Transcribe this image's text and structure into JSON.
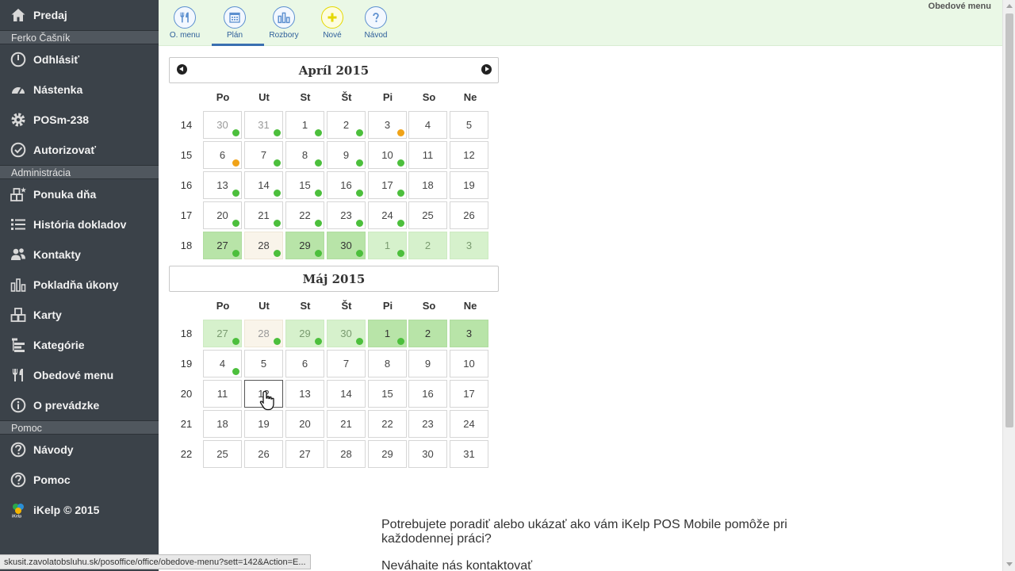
{
  "sidebar": {
    "top": {
      "label": "Predaj",
      "icon": "home-icon"
    },
    "section_user": "Ferko Čašník",
    "group1": [
      {
        "label": "Odhlásiť",
        "icon": "power-icon"
      },
      {
        "label": "Nástenka",
        "icon": "dashboard-icon"
      },
      {
        "label": "POSm-238",
        "icon": "gear-icon"
      },
      {
        "label": "Autorizovať",
        "icon": "check-circle-icon"
      }
    ],
    "section_admin": "Administrácia",
    "group2": [
      {
        "label": "Ponuka dňa",
        "icon": "boxes-star-icon"
      },
      {
        "label": "História dokladov",
        "icon": "list-icon"
      },
      {
        "label": "Kontakty",
        "icon": "users-icon"
      },
      {
        "label": "Pokladňa úkony",
        "icon": "bar-chart-icon"
      },
      {
        "label": "Karty",
        "icon": "cards-icon"
      },
      {
        "label": "Kategórie",
        "icon": "tree-icon"
      },
      {
        "label": "Obedové menu",
        "icon": "fork-knife-icon"
      },
      {
        "label": "O prevádzke",
        "icon": "info-icon"
      }
    ],
    "section_help": "Pomoc",
    "group3": [
      {
        "label": "Návody",
        "icon": "question-icon"
      },
      {
        "label": "Pomoc",
        "icon": "question-icon"
      },
      {
        "label": "iKelp © 2015",
        "icon": "ikelp-logo-icon"
      }
    ]
  },
  "toolbar": {
    "buttons": [
      {
        "label": "O. menu",
        "icon": "fork-knife-icon"
      },
      {
        "label": "Plán",
        "icon": "calendar-icon",
        "active": true
      },
      {
        "label": "Rozbory",
        "icon": "bar-chart-icon"
      },
      {
        "label": "Nové",
        "icon": "plus-icon"
      },
      {
        "label": "Návod",
        "icon": "question-icon"
      }
    ],
    "page_title": "Obedové menu"
  },
  "weekdays": [
    "Po",
    "Ut",
    "St",
    "Št",
    "Pi",
    "So",
    "Ne"
  ],
  "calendars": [
    {
      "title": "Apríl 2015",
      "weeks": [
        {
          "num": "14",
          "days": [
            {
              "d": "30",
              "other": true,
              "dot": "green"
            },
            {
              "d": "31",
              "other": true,
              "dot": "green"
            },
            {
              "d": "1",
              "dot": "green"
            },
            {
              "d": "2",
              "dot": "green"
            },
            {
              "d": "3",
              "dot": "orange"
            },
            {
              "d": "4"
            },
            {
              "d": "5"
            }
          ]
        },
        {
          "num": "15",
          "days": [
            {
              "d": "6",
              "dot": "orange"
            },
            {
              "d": "7",
              "dot": "green"
            },
            {
              "d": "8",
              "dot": "green"
            },
            {
              "d": "9",
              "dot": "green"
            },
            {
              "d": "10",
              "dot": "green"
            },
            {
              "d": "11"
            },
            {
              "d": "12"
            }
          ]
        },
        {
          "num": "16",
          "days": [
            {
              "d": "13",
              "dot": "green"
            },
            {
              "d": "14",
              "dot": "green"
            },
            {
              "d": "15",
              "dot": "green"
            },
            {
              "d": "16",
              "dot": "green"
            },
            {
              "d": "17",
              "dot": "green"
            },
            {
              "d": "18"
            },
            {
              "d": "19"
            }
          ]
        },
        {
          "num": "17",
          "days": [
            {
              "d": "20",
              "dot": "green"
            },
            {
              "d": "21",
              "dot": "green"
            },
            {
              "d": "22",
              "dot": "green"
            },
            {
              "d": "23",
              "dot": "green"
            },
            {
              "d": "24",
              "dot": "green"
            },
            {
              "d": "25"
            },
            {
              "d": "26"
            }
          ]
        },
        {
          "num": "18",
          "days": [
            {
              "d": "27",
              "hl": "g-strong",
              "dot": "green"
            },
            {
              "d": "28",
              "hl": "cream",
              "dot": "green"
            },
            {
              "d": "29",
              "hl": "g-strong",
              "dot": "green"
            },
            {
              "d": "30",
              "hl": "g-strong",
              "dot": "green"
            },
            {
              "d": "1",
              "other": true,
              "hl": "g-light",
              "dot": "green"
            },
            {
              "d": "2",
              "other": true,
              "hl": "g-light"
            },
            {
              "d": "3",
              "other": true,
              "hl": "g-light"
            }
          ]
        }
      ]
    },
    {
      "title": "Máj 2015",
      "weeks": [
        {
          "num": "18",
          "days": [
            {
              "d": "27",
              "other": true,
              "hl": "g-light",
              "dot": "green"
            },
            {
              "d": "28",
              "other": true,
              "hl": "cream",
              "dot": "green"
            },
            {
              "d": "29",
              "other": true,
              "hl": "g-light",
              "dot": "green"
            },
            {
              "d": "30",
              "other": true,
              "hl": "g-light",
              "dot": "green"
            },
            {
              "d": "1",
              "hl": "g-strong",
              "dot": "green"
            },
            {
              "d": "2",
              "hl": "g-strong"
            },
            {
              "d": "3",
              "hl": "g-strong"
            }
          ]
        },
        {
          "num": "19",
          "days": [
            {
              "d": "4",
              "dot": "green"
            },
            {
              "d": "5"
            },
            {
              "d": "6"
            },
            {
              "d": "7"
            },
            {
              "d": "8"
            },
            {
              "d": "9"
            },
            {
              "d": "10"
            }
          ]
        },
        {
          "num": "20",
          "days": [
            {
              "d": "11"
            },
            {
              "d": "12",
              "today": true
            },
            {
              "d": "13"
            },
            {
              "d": "14"
            },
            {
              "d": "15"
            },
            {
              "d": "16"
            },
            {
              "d": "17"
            }
          ]
        },
        {
          "num": "21",
          "days": [
            {
              "d": "18"
            },
            {
              "d": "19"
            },
            {
              "d": "20"
            },
            {
              "d": "21"
            },
            {
              "d": "22"
            },
            {
              "d": "23"
            },
            {
              "d": "24"
            }
          ]
        },
        {
          "num": "22",
          "days": [
            {
              "d": "25"
            },
            {
              "d": "26"
            },
            {
              "d": "27"
            },
            {
              "d": "28"
            },
            {
              "d": "29"
            },
            {
              "d": "30"
            },
            {
              "d": "31"
            }
          ]
        }
      ]
    }
  ],
  "help": {
    "line1": "Potrebujete poradiť alebo ukázať ako vám iKelp POS Mobile pomôže pri každodennej práci?",
    "line2": "Neváhaite nás kontaktovať"
  },
  "status_url": "skusit.zavolatobsluhu.sk/posoffice/office/obedove-menu?sett=142&Action=E...",
  "colors": {
    "sidebar_bg": "#3b4249",
    "toolbar_bg": "#eaf8e6",
    "dot_green": "#4cbf3c",
    "dot_orange": "#f0a318",
    "highlight_strong": "#b8e4a8",
    "highlight_light": "#d6f1cc"
  }
}
